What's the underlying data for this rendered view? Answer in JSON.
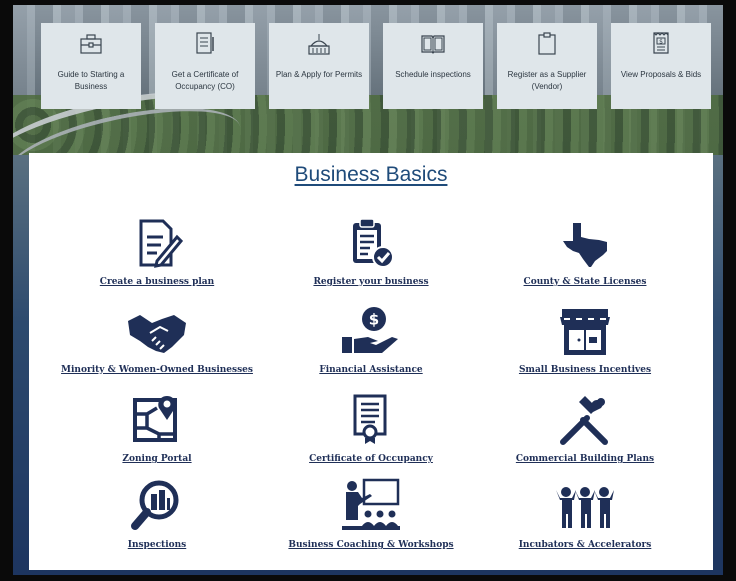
{
  "top_tiles": [
    {
      "label": "Guide to Starting a Business",
      "icon": "briefcase-icon"
    },
    {
      "label": "Get a Certificate of Occupancy (CO)",
      "icon": "document-icon"
    },
    {
      "label": "Plan & Apply for Permits",
      "icon": "capitol-building-icon"
    },
    {
      "label": "Schedule inspections",
      "icon": "open-book-icon"
    },
    {
      "label": "Register as a Supplier (Vendor)",
      "icon": "clipboard-icon"
    },
    {
      "label": "View Proposals & Bids",
      "icon": "invoice-dollar-icon"
    }
  ],
  "section_title": "Business Basics",
  "items": [
    {
      "label": "Create a business plan",
      "icon": "document-pen-icon"
    },
    {
      "label": "Register your business",
      "icon": "clipboard-check-icon"
    },
    {
      "label": "County & State Licenses",
      "icon": "texas-map-icon"
    },
    {
      "label": "Minority & Women-Owned Businesses",
      "icon": "handshake-icon"
    },
    {
      "label": "Financial Assistance",
      "icon": "hand-dollar-icon"
    },
    {
      "label": "Small Business Incentives",
      "icon": "storefront-icon"
    },
    {
      "label": "Zoning Portal",
      "icon": "map-pin-icon"
    },
    {
      "label": "Certificate of Occupancy",
      "icon": "certificate-icon"
    },
    {
      "label": "Commercial Building Plans",
      "icon": "hammer-wrench-icon"
    },
    {
      "label": "Inspections",
      "icon": "magnify-building-icon"
    },
    {
      "label": "Business Coaching & Workshops",
      "icon": "presentation-icon"
    },
    {
      "label": "Incubators & Accelerators",
      "icon": "team-icon"
    }
  ],
  "colors": {
    "icon": "#1f2f57",
    "title": "#1f4b7a",
    "tile_bg": "#dfe6ea"
  }
}
